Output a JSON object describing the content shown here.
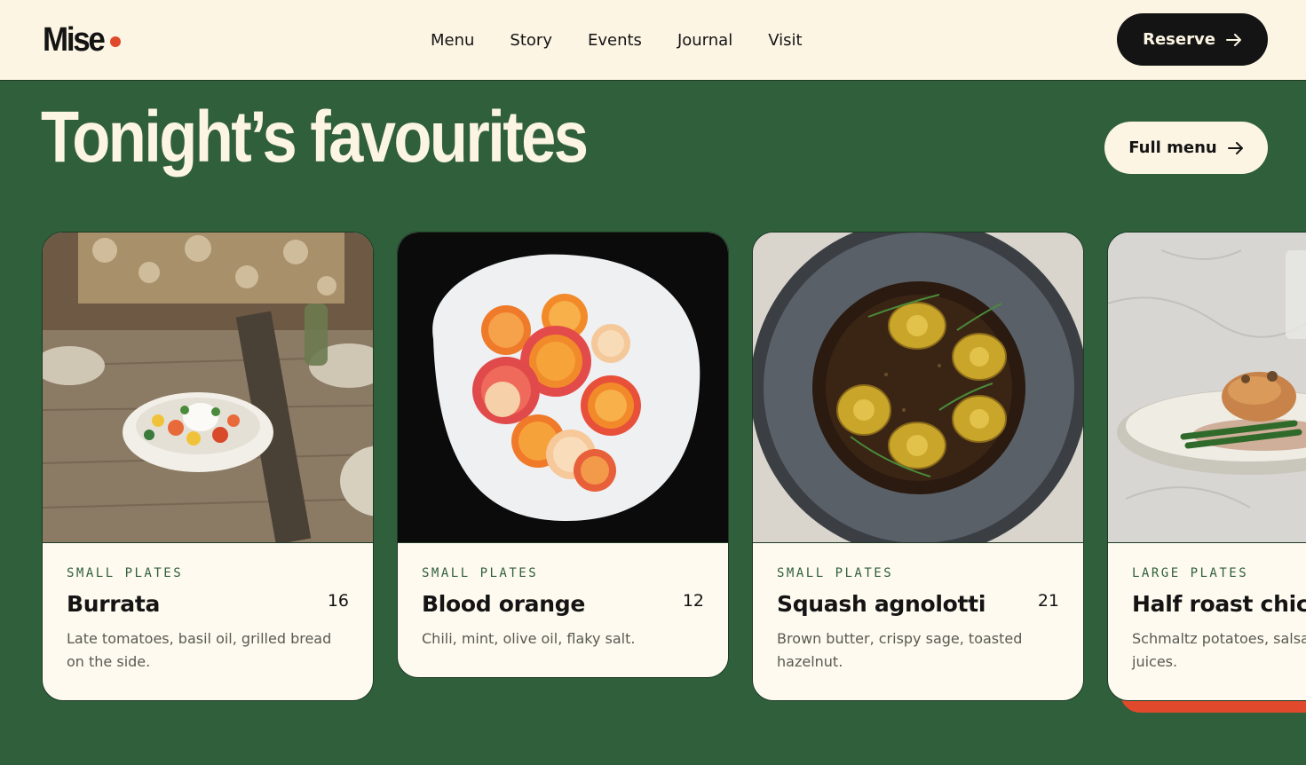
{
  "brand": {
    "name": "Mise",
    "dot_color": "#e0492c"
  },
  "nav": {
    "links": [
      "Menu",
      "Story",
      "Events",
      "Journal",
      "Visit"
    ]
  },
  "header": {
    "reserve_label": "Reserve"
  },
  "section": {
    "title": "Tonight’s favourites",
    "full_menu_label": "Full menu"
  },
  "colors": {
    "background": "#2f5f3b",
    "cream": "#fdf5e4",
    "dark": "#141414",
    "accent": "#e0492c"
  },
  "cards": [
    {
      "category": "SMALL PLATES",
      "name": "Burrata",
      "price": "16",
      "description": "Late tomatoes, basil oil, grilled bread on the side.",
      "image": "burrata-photo"
    },
    {
      "category": "SMALL PLATES",
      "name": "Blood orange",
      "price": "12",
      "description": "Chili, mint, olive oil, flaky salt.",
      "image": "blood-orange-photo"
    },
    {
      "category": "SMALL PLATES",
      "name": "Squash agnolotti",
      "price": "21",
      "description": "Brown butter, crispy sage, toasted hazelnut.",
      "image": "agnolotti-photo"
    },
    {
      "category": "LARGE PLATES",
      "name": "Half roast chicken",
      "price": "",
      "description": "Schmaltz potatoes, salsa verde, pan juices.",
      "image": "chicken-photo"
    }
  ]
}
